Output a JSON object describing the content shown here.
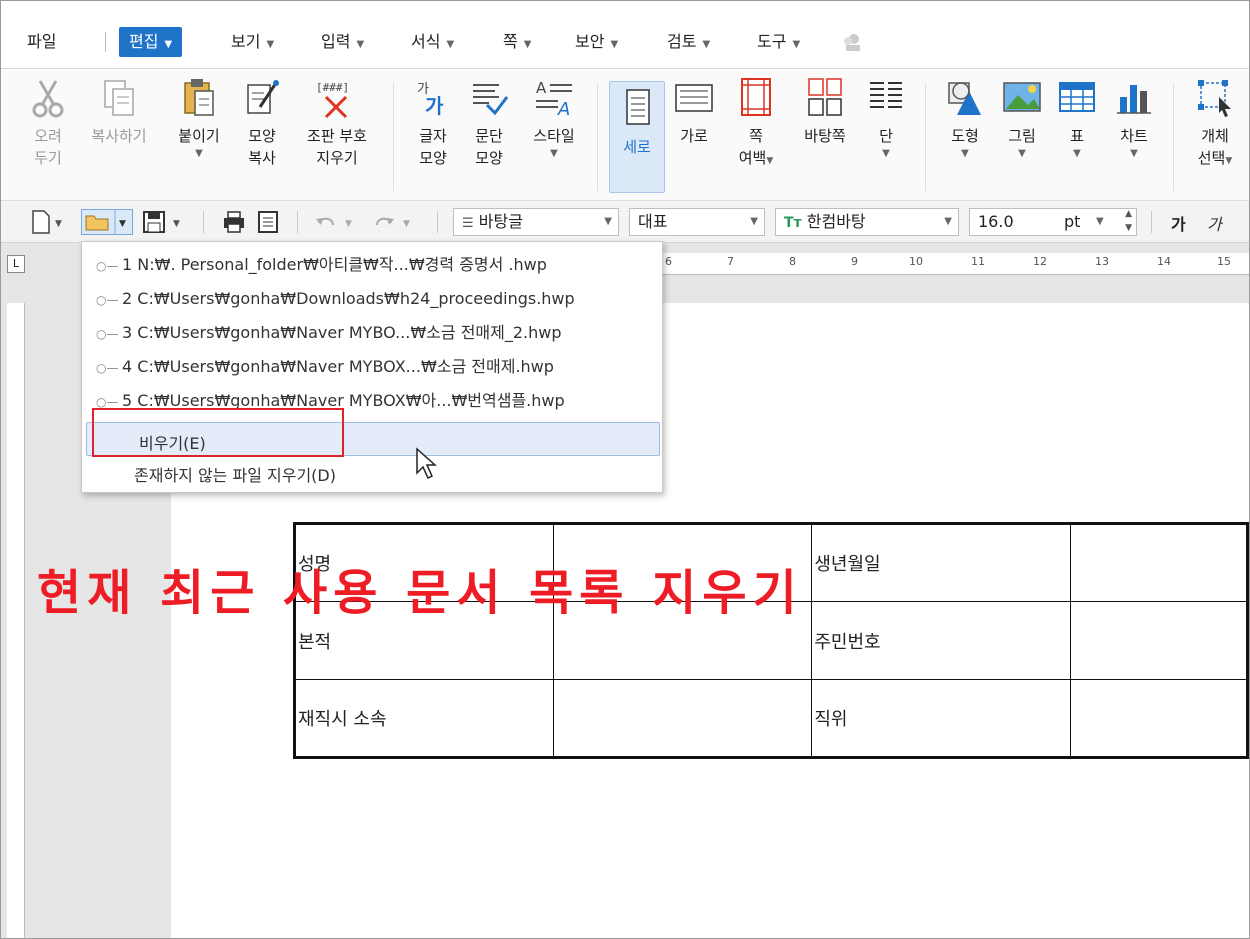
{
  "menubar": {
    "items": [
      {
        "label": "파일"
      },
      {
        "label": "편집"
      },
      {
        "label": "보기"
      },
      {
        "label": "입력"
      },
      {
        "label": "서식"
      },
      {
        "label": "쪽"
      },
      {
        "label": "보안"
      },
      {
        "label": "검토"
      },
      {
        "label": "도구"
      }
    ],
    "active": "편집",
    "accent": "#1f74c9"
  },
  "ribbon": {
    "cut": {
      "l1": "오려",
      "l2": "두기"
    },
    "copy": {
      "l1": "복사하기"
    },
    "paste": {
      "l1": "붙이기"
    },
    "format_copy": {
      "l1": "모양",
      "l2": "복사"
    },
    "clear_marks": {
      "l1": "조판 부호",
      "l2": "지우기"
    },
    "char_shape": {
      "l1": "글자",
      "l2": "모양"
    },
    "para_shape": {
      "l1": "문단",
      "l2": "모양"
    },
    "style": {
      "l1": "스타일"
    },
    "portrait": {
      "l1": "세로"
    },
    "landscape": {
      "l1": "가로"
    },
    "margin": {
      "l1": "쪽",
      "l2": "여백"
    },
    "master": {
      "l1": "바탕쪽"
    },
    "columns": {
      "l1": "단"
    },
    "shape": {
      "l1": "도형"
    },
    "picture": {
      "l1": "그림"
    },
    "table": {
      "l1": "표"
    },
    "chart": {
      "l1": "차트"
    },
    "select_obj": {
      "l1": "개체",
      "l2": "선택"
    }
  },
  "toolbar": {
    "style_combo": "바탕글",
    "lang_combo": "대표",
    "font_combo": "한컴바탕",
    "size_value": "16.0",
    "size_unit": "pt",
    "bold": "가",
    "italic": "가"
  },
  "ruler": {
    "corner": "L",
    "numbers": [
      "6",
      "7",
      "8",
      "9",
      "10",
      "11",
      "12",
      "13",
      "14",
      "15"
    ]
  },
  "recent_files": {
    "items": [
      "1 N:₩. Personal_folder₩아티클₩작...₩경력 증명서 .hwp",
      "2 C:₩Users₩gonha₩Downloads₩h24_proceedings.hwp",
      "3 C:₩Users₩gonha₩Naver MYBO...₩소금 전매제_2.hwp",
      "4 C:₩Users₩gonha₩Naver MYBOX...₩소금 전매제.hwp",
      "5 C:₩Users₩gonha₩Naver MYBOX₩아...₩번역샘플.hwp"
    ],
    "clear": "비우기(E)",
    "remove_missing": "존재하지 않는 파일 지우기(D)"
  },
  "document": {
    "rows": [
      [
        "성명",
        "",
        "생년월일",
        ""
      ],
      [
        "본적",
        "",
        "주민번호",
        ""
      ],
      [
        "재직시  소속",
        "",
        "직위",
        ""
      ]
    ]
  },
  "annotation": {
    "text": "현재 최근 사용 문서 목록 지우기",
    "color": "#ee1c24"
  }
}
